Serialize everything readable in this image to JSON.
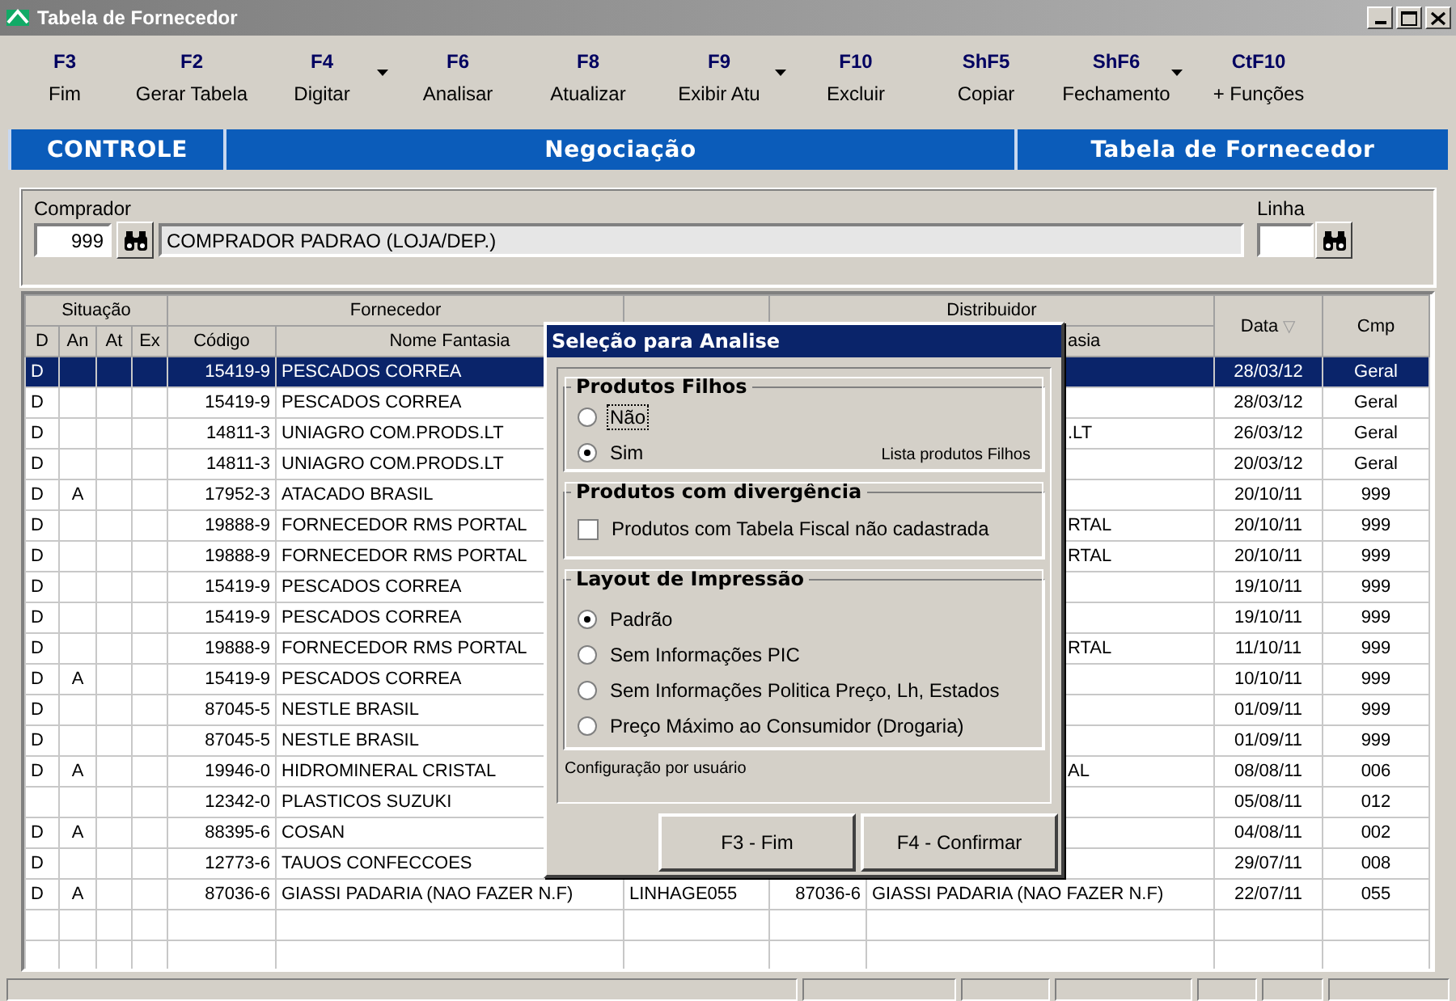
{
  "window": {
    "title": "Tabela de Fornecedor"
  },
  "toolbar": [
    {
      "key": "F3",
      "label": "Fim",
      "dropdown": false
    },
    {
      "key": "F2",
      "label": "Gerar Tabela",
      "dropdown": false
    },
    {
      "key": "F4",
      "label": "Digitar",
      "dropdown": true
    },
    {
      "key": "F6",
      "label": "Analisar",
      "dropdown": false
    },
    {
      "key": "F8",
      "label": "Atualizar",
      "dropdown": false
    },
    {
      "key": "F9",
      "label": "Exibir Atu",
      "dropdown": true
    },
    {
      "key": "F10",
      "label": "Excluir",
      "dropdown": false
    },
    {
      "key": "ShF5",
      "label": "Copiar",
      "dropdown": false
    },
    {
      "key": "ShF6",
      "label": "Fechamento",
      "dropdown": true
    },
    {
      "key": "CtF10",
      "label": "+ Funções",
      "dropdown": false
    }
  ],
  "nav": [
    {
      "label": "CONTROLE"
    },
    {
      "label": "Negociação"
    },
    {
      "label": "Tabela de Fornecedor"
    }
  ],
  "filter": {
    "comprador": {
      "label": "Comprador",
      "code": "999",
      "name": "COMPRADOR PADRAO (LOJA/DEP.)"
    },
    "linha": {
      "label": "Linha"
    }
  },
  "table": {
    "group_headers": [
      "Situação",
      "Fornecedor",
      "Distribuidor"
    ],
    "columns": [
      {
        "label": "D"
      },
      {
        "label": "An"
      },
      {
        "label": "At"
      },
      {
        "label": "Ex"
      },
      {
        "label": "Código"
      },
      {
        "label": "Nome Fantasia"
      },
      {
        "label": "asia",
        "clipped": true
      },
      {
        "label": "Data",
        "sort_mark": "▽"
      },
      {
        "label": "Cmp"
      }
    ],
    "rows": [
      {
        "d": "D",
        "codigo": "15419-9",
        "nome": "PESCADOS CORREA",
        "data": "28/03/12",
        "cmp": "Geral",
        "selected": true
      },
      {
        "d": "D",
        "codigo": "15419-9",
        "nome": "PESCADOS CORREA",
        "data": "28/03/12",
        "cmp": "Geral",
        "selected": false
      },
      {
        "d": "D",
        "codigo": "14811-3",
        "nome": "UNIAGRO COM.PRODS.LT",
        "dist_nome": ".LT",
        "dist_clipped": true,
        "data": "26/03/12",
        "cmp": "Geral",
        "selected": false
      },
      {
        "d": "D",
        "codigo": "14811-3",
        "nome": "UNIAGRO COM.PRODS.LT",
        "data": "20/03/12",
        "cmp": "Geral",
        "selected": false
      },
      {
        "d": "D",
        "an": "A",
        "codigo": "17952-3",
        "nome": "ATACADO BRASIL",
        "data": "20/10/11",
        "cmp": "999",
        "selected": false
      },
      {
        "d": "D",
        "codigo": "19888-9",
        "nome": "FORNECEDOR RMS PORTAL",
        "dist_nome": "RTAL",
        "dist_clipped": true,
        "data": "20/10/11",
        "cmp": "999",
        "selected": false
      },
      {
        "d": "D",
        "codigo": "19888-9",
        "nome": "FORNECEDOR RMS PORTAL",
        "dist_nome": "RTAL",
        "dist_clipped": true,
        "data": "20/10/11",
        "cmp": "999",
        "selected": false
      },
      {
        "d": "D",
        "codigo": "15419-9",
        "nome": "PESCADOS CORREA",
        "data": "19/10/11",
        "cmp": "999",
        "selected": false
      },
      {
        "d": "D",
        "codigo": "15419-9",
        "nome": "PESCADOS CORREA",
        "data": "19/10/11",
        "cmp": "999",
        "selected": false
      },
      {
        "d": "D",
        "codigo": "19888-9",
        "nome": "FORNECEDOR RMS PORTAL",
        "dist_nome": "RTAL",
        "dist_clipped": true,
        "data": "11/10/11",
        "cmp": "999",
        "selected": false
      },
      {
        "d": "D",
        "an": "A",
        "codigo": "15419-9",
        "nome": "PESCADOS CORREA",
        "data": "10/10/11",
        "cmp": "999",
        "selected": false
      },
      {
        "d": "D",
        "codigo": "87045-5",
        "nome": "NESTLE BRASIL",
        "data": "01/09/11",
        "cmp": "999",
        "selected": false
      },
      {
        "d": "D",
        "codigo": "87045-5",
        "nome": "NESTLE BRASIL",
        "data": "01/09/11",
        "cmp": "999",
        "selected": false
      },
      {
        "d": "D",
        "an": "A",
        "codigo": "19946-0",
        "nome": "HIDROMINERAL CRISTAL",
        "dist_nome": "AL",
        "dist_clipped": true,
        "data": "08/08/11",
        "cmp": "006",
        "selected": false
      },
      {
        "codigo": "12342-0",
        "nome": "PLASTICOS SUZUKI",
        "data": "05/08/11",
        "cmp": "012",
        "selected": false
      },
      {
        "d": "D",
        "an": "A",
        "codigo": "88395-6",
        "nome": "COSAN",
        "data": "04/08/11",
        "cmp": "002",
        "selected": false
      },
      {
        "d": "D",
        "codigo": "12773-6",
        "nome": "TAUOS CONFECCOES",
        "data": "29/07/11",
        "cmp": "008",
        "selected": false
      },
      {
        "d": "D",
        "an": "A",
        "codigo": "87036-6",
        "nome": "GIASSI PADARIA (NAO FAZER N.F)",
        "linha": "LINHAGE055",
        "dist_codigo": "87036-6",
        "dist_nome": "GIASSI PADARIA (NAO FAZER N.F)",
        "data": "22/07/11",
        "cmp": "055",
        "selected": false
      }
    ]
  },
  "dialog": {
    "title": "Seleção para Analise",
    "sections": [
      {
        "kind": "radio",
        "title": "Produtos Filhos",
        "options": [
          {
            "label": "Não",
            "selected": false,
            "focused": true
          },
          {
            "label": "Sim",
            "selected": true,
            "focused": false
          }
        ],
        "note": "Lista produtos Filhos"
      },
      {
        "kind": "checkbox",
        "title": "Produtos com divergência",
        "options": [
          {
            "label": "Produtos com Tabela Fiscal não cadastrada",
            "checked": false
          }
        ]
      },
      {
        "kind": "radio",
        "title": "Layout de Impressão",
        "options": [
          {
            "label": "Padrão",
            "selected": true,
            "focused": false
          },
          {
            "label": "Sem Informações PIC",
            "selected": false,
            "focused": false
          },
          {
            "label": "Sem Informações Politica Preço, Lh, Estados",
            "selected": false,
            "focused": false
          },
          {
            "label": "Preço Máximo ao Consumidor (Drogaria)",
            "selected": false,
            "focused": false
          }
        ]
      }
    ],
    "footer": "Configuração por usuário",
    "buttons": [
      "F3 - Fim",
      "F4 - Confirmar"
    ]
  }
}
